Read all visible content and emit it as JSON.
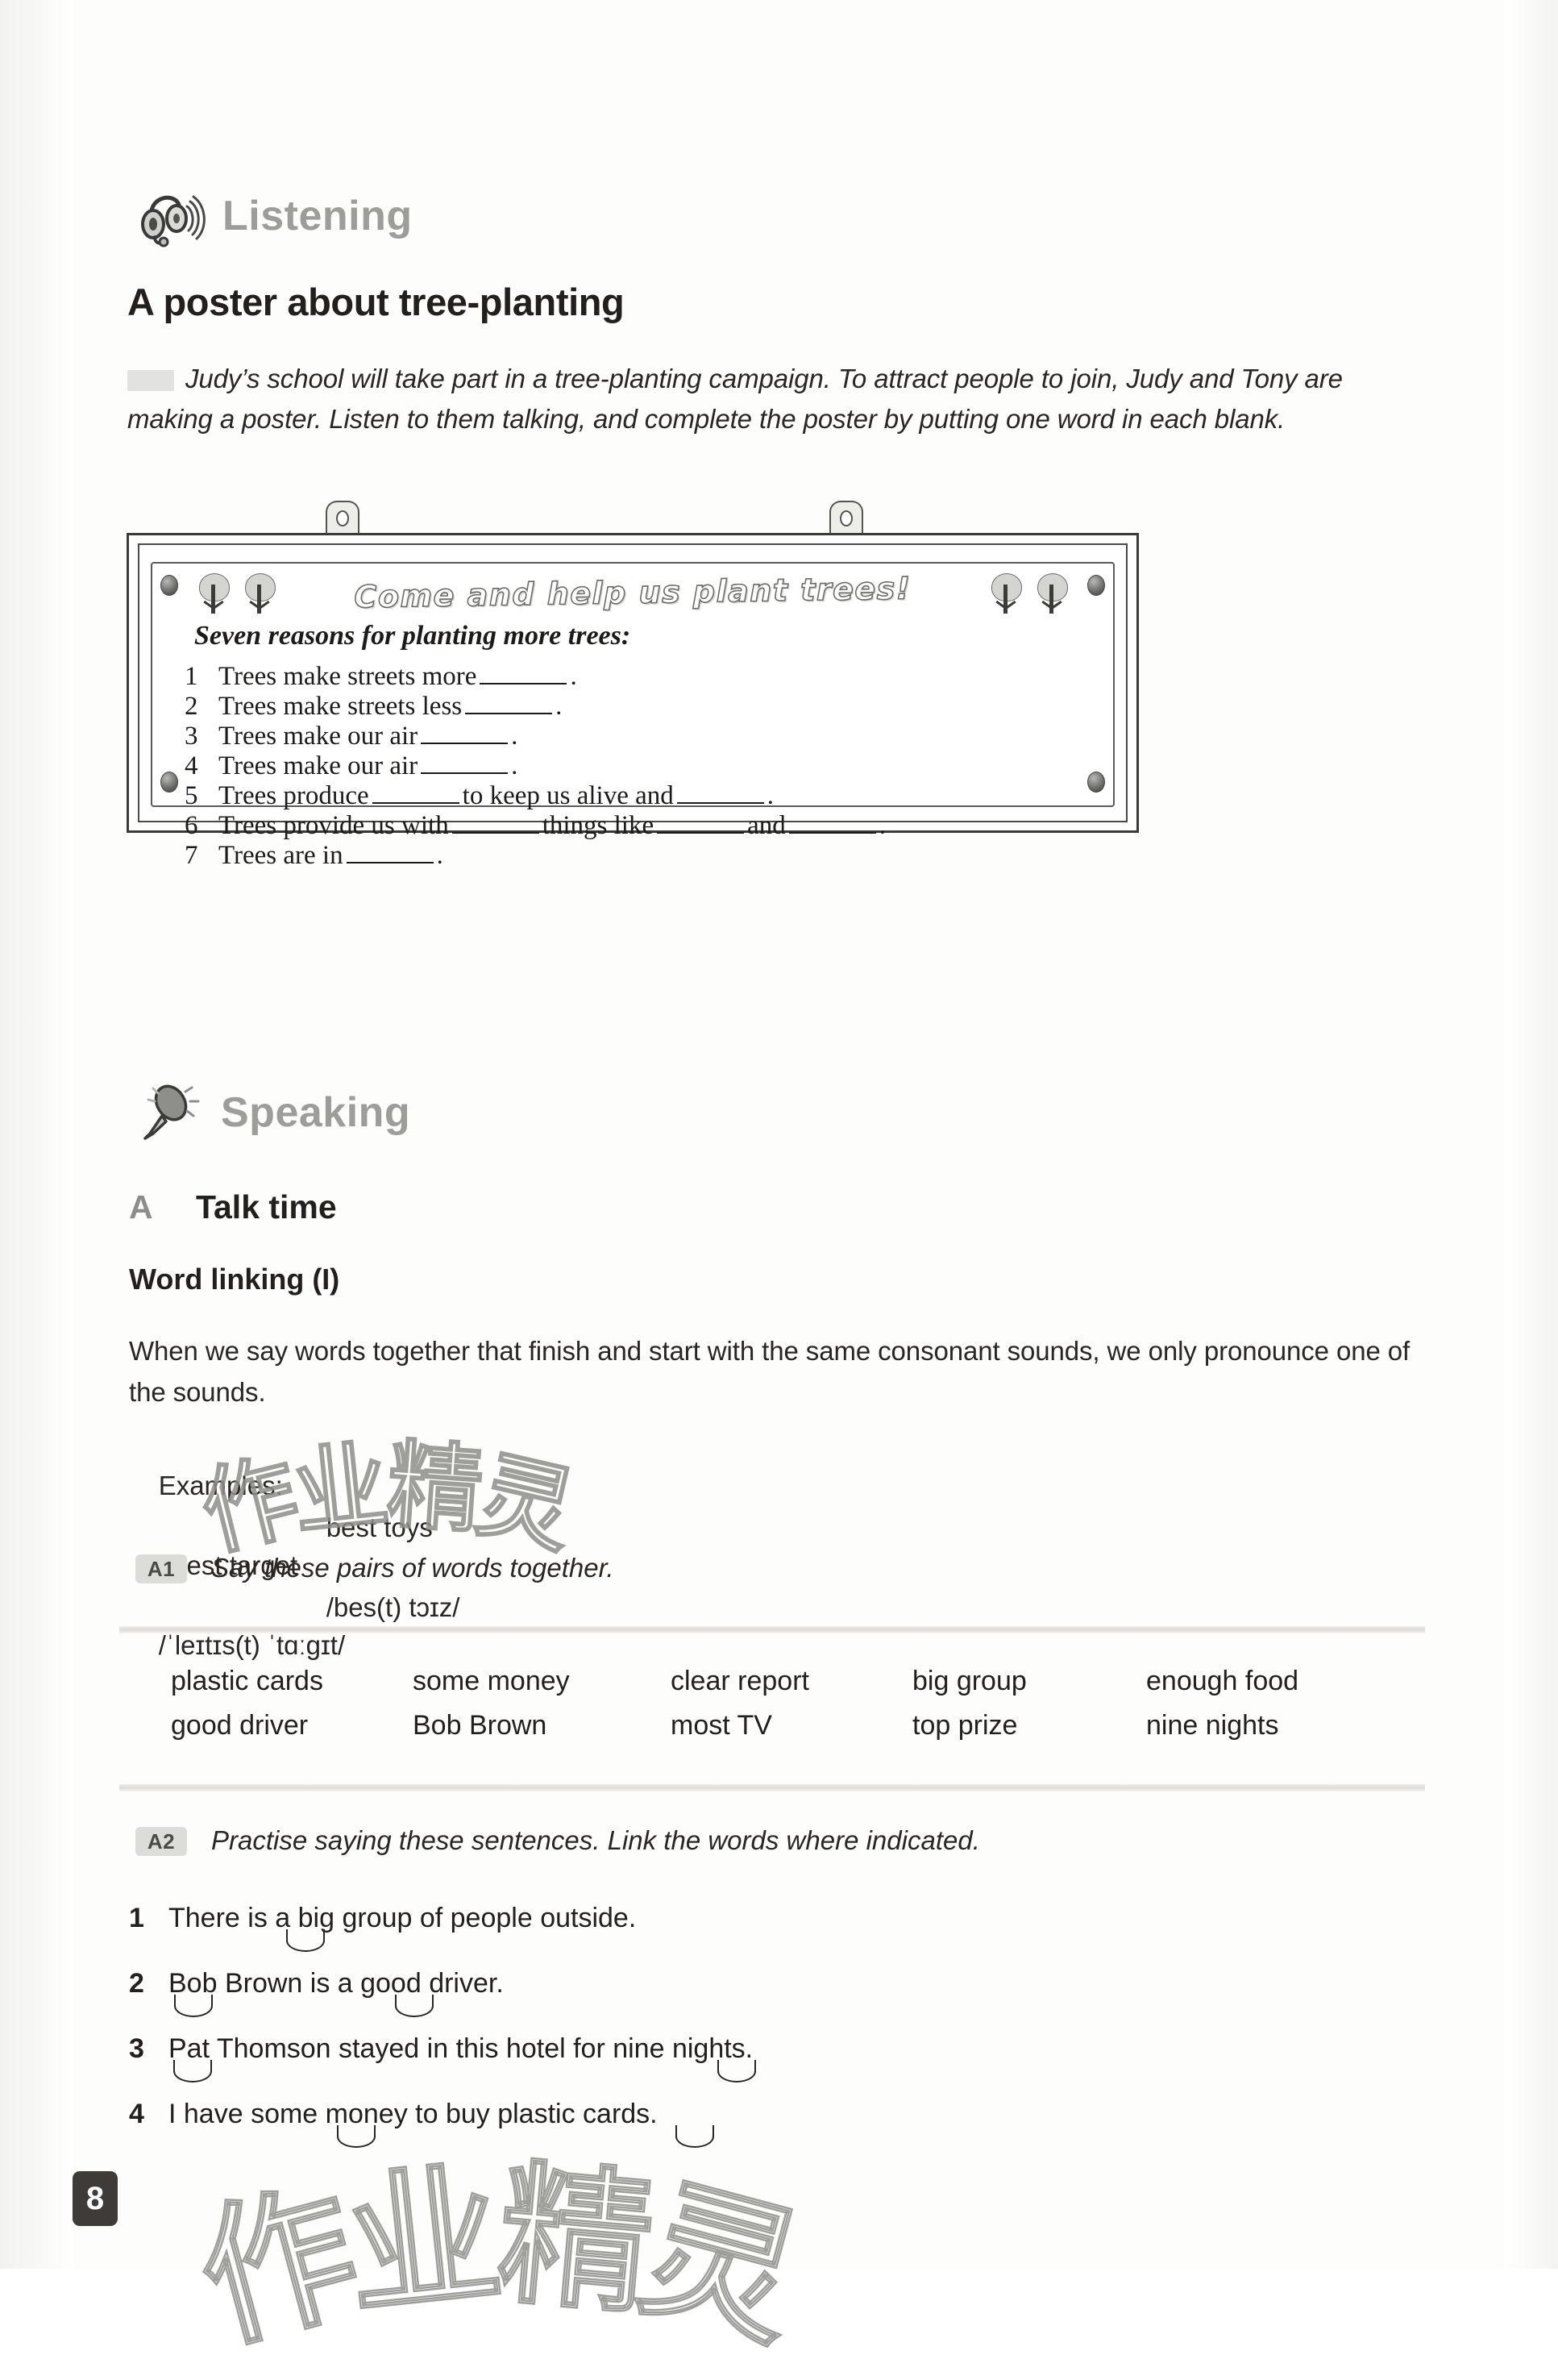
{
  "page": {
    "number": "8",
    "watermark_text": "作业精灵"
  },
  "listening": {
    "section_label": "Listening",
    "icon": "headphones-icon",
    "topic_title": "A poster about tree-planting",
    "intro": "Judy’s school will take part in a tree-planting campaign. To attract people to join, Judy and Tony are making a poster. Listen to them talking, and complete the poster by putting one word in each blank.",
    "poster": {
      "banner": "Come and help us plant trees!",
      "list_heading": "Seven reasons for planting more trees:",
      "items": [
        {
          "num": "1",
          "text_before": "Trees make streets more",
          "text_after": "."
        },
        {
          "num": "2",
          "text_before": "Trees make streets less",
          "text_after": "."
        },
        {
          "num": "3",
          "text_before": "Trees make our air",
          "text_after": "."
        },
        {
          "num": "4",
          "text_before": "Trees make our air",
          "text_after": "."
        },
        {
          "num": "5",
          "text_before": "Trees produce",
          "text_mid": "to keep us alive and",
          "text_after": "."
        },
        {
          "num": "6",
          "text_before": "Trees provide us with",
          "text_mid": "things like",
          "text_mid2": "and",
          "text_after": "."
        },
        {
          "num": "7",
          "text_before": "Trees are in",
          "text_after": "."
        }
      ]
    }
  },
  "speaking": {
    "section_label": "Speaking",
    "icon": "microphone-icon",
    "task_letter": "A",
    "task_name": "Talk time",
    "subheading": "Word linking (I)",
    "explanation": "When we say words together that finish and start with the same consonant sounds, we only pronounce one of the sounds.",
    "examples_label": "Examples:",
    "examples": [
      {
        "words": "latest target",
        "phonetic": "/ˈleɪtɪs(t) ˈtɑːgɪt/"
      },
      {
        "words": "best toys",
        "phonetic": "/bes(t) tɔɪz/"
      }
    ],
    "a1": {
      "badge": "A1",
      "instruction": "Say these pairs of words together.",
      "pairs": [
        "plastic cards",
        "some money",
        "clear report",
        "big group",
        "enough food",
        "good driver",
        "Bob Brown",
        "most TV",
        "top prize",
        "nine nights"
      ]
    },
    "a2": {
      "badge": "A2",
      "instruction": "Practise saying these sentences. Link the words where indicated.",
      "sentences": [
        {
          "num": "1",
          "text": "There is a big group of people outside."
        },
        {
          "num": "2",
          "text": "Bob Brown is a good driver."
        },
        {
          "num": "3",
          "text": "Pat Thomson stayed in this hotel for nine nights."
        },
        {
          "num": "4",
          "text": "I have some money to buy plastic cards."
        }
      ]
    }
  },
  "colors": {
    "section_gray": "#9d9d99",
    "body_ink": "#2a2623",
    "badge_bg": "#dcdcd9",
    "folio_bg": "#3f3b39"
  }
}
